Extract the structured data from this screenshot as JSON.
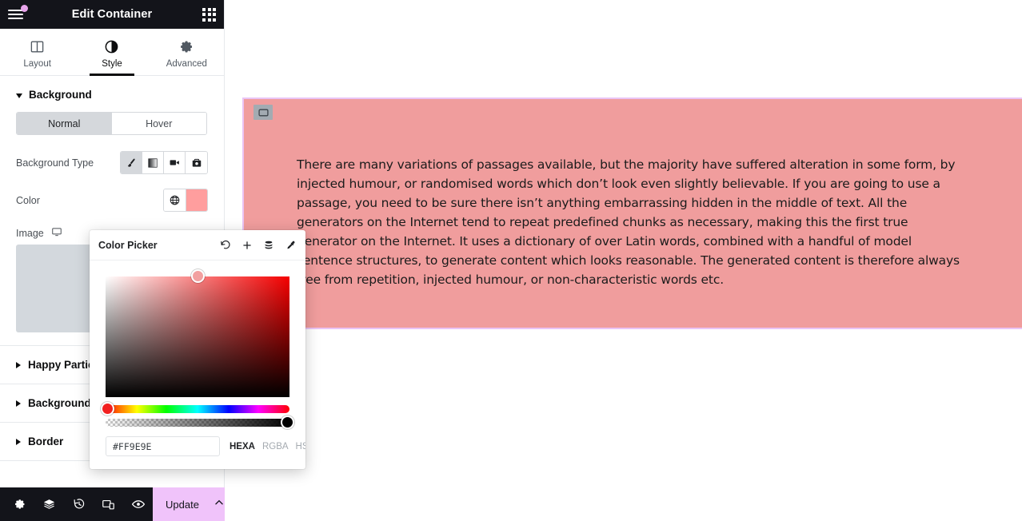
{
  "panel": {
    "header": {
      "title": "Edit Container",
      "menu_icon": "hamburger-icon",
      "apps_icon": "grid-apps-icon",
      "notification_dot_color": "#e8a5ec"
    },
    "tabs": [
      {
        "label": "Layout",
        "icon": "layout-icon",
        "active": false
      },
      {
        "label": "Style",
        "icon": "contrast-circle-icon",
        "active": true
      },
      {
        "label": "Advanced",
        "icon": "gear-icon",
        "active": false
      }
    ],
    "background_section": {
      "title": "Background",
      "expanded": true,
      "states": [
        {
          "label": "Normal",
          "active": true
        },
        {
          "label": "Hover",
          "active": false
        }
      ],
      "background_type": {
        "label": "Background Type",
        "options": [
          {
            "icon": "brush-icon",
            "name": "classic",
            "active": true
          },
          {
            "icon": "gradient-icon",
            "name": "gradient",
            "active": false
          },
          {
            "icon": "video-camera-icon",
            "name": "video",
            "active": false
          },
          {
            "icon": "slideshow-icon",
            "name": "slideshow",
            "active": false
          }
        ]
      },
      "color": {
        "label": "Color",
        "globe_icon": "globe-icon",
        "swatch_value": "#ff9e9e"
      },
      "image": {
        "label": "Image",
        "device_icon": "desktop-icon",
        "dropzone_color": "#d3d8dd"
      }
    },
    "collapsed_sections": [
      {
        "label": "Happy Partic",
        "expanded": false
      },
      {
        "label": "Background",
        "expanded": false
      },
      {
        "label": "Border",
        "expanded": false
      }
    ],
    "footer": {
      "icons": [
        {
          "name": "gear-icon",
          "title": "Settings"
        },
        {
          "name": "layers-icon",
          "title": "Navigator"
        },
        {
          "name": "history-icon",
          "title": "History"
        },
        {
          "name": "responsive-icon",
          "title": "Responsive Mode"
        },
        {
          "name": "eye-icon",
          "title": "Preview Changes"
        }
      ],
      "update_label": "Update",
      "update_bg": "#f0c3fa",
      "chevron_icon": "chevron-up-icon"
    }
  },
  "canvas": {
    "container": {
      "handle_icon": "container-handle-icon",
      "background_color": "#f09d9d",
      "outline_color": "#eac4f5",
      "text": "There are many variations of passages available, but the majority have suffered alteration in some form, by injected humour, or randomised words which don’t look even slightly believable. If you are going to use a passage, you need to be sure there isn’t anything embarrassing hidden in the middle of text. All the generators on the Internet tend to repeat predefined chunks as necessary, making this the first true generator on the Internet. It uses a dictionary of over Latin words, combined with a handful of model sentence structures, to generate content which looks reasonable. The generated content is therefore always free from repetition, injected humour, or non-characteristic words etc."
    }
  },
  "color_picker": {
    "title": "Color Picker",
    "actions": [
      {
        "name": "reset-icon",
        "title": "Reset"
      },
      {
        "name": "plus-icon",
        "title": "Add"
      },
      {
        "name": "swatches-icon",
        "title": "Saved Colors"
      },
      {
        "name": "eyedropper-icon",
        "title": "Pick Color"
      }
    ],
    "hex_value": "#FF9E9E",
    "hex_placeholder": "#FF9E9E",
    "modes": [
      {
        "label": "HEXA",
        "active": true
      },
      {
        "label": "RGBA",
        "active": false
      },
      {
        "label": "HSLA",
        "active": false
      }
    ]
  }
}
